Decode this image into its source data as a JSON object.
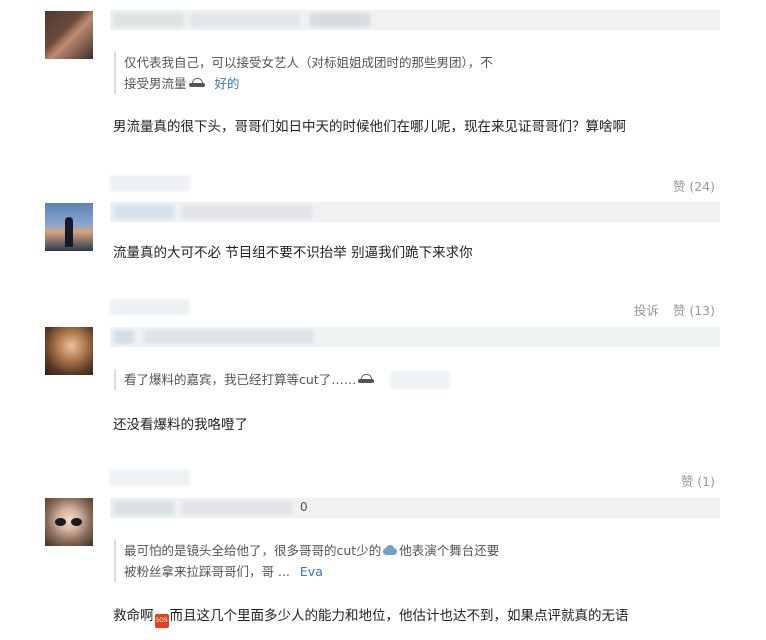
{
  "comments": [
    {
      "quote_text_line1": "仅代表我自己，可以接受女艺人（对标姐姐成团时的那些男团），不",
      "quote_text_line2": "接受男流量",
      "quote_link": "好的",
      "icon": "shoe-icon",
      "text": "男流量真的很下头，哥哥们如日中天的时候他们在哪儿呢，现在来见证哥哥们？算啥啊",
      "likes": "赞 (24)"
    },
    {
      "text": "流量真的大可不必 节目组不要不识抬举 别逼我们跪下来求你",
      "report": "投诉",
      "likes": "赞 (13)"
    },
    {
      "quote_text": "看了爆料的嘉宾，我已经打算等cut了……",
      "icon": "shoe-icon",
      "text": "还没看爆料的我咯噔了",
      "likes": "赞 (1)"
    },
    {
      "name_suffix": "0",
      "quote_text_line1a": "最可怕的是镜头全给他了，很多哥哥的cut少的",
      "quote_text_line1b": "他表演个舞台还要",
      "quote_text_line2": "被粉丝拿来拉踩哥哥们，哥 ...",
      "quote_link": "Eva",
      "text_a": "救命啊",
      "text_b": "而且这几个里面多少人的能力和地位，他估计也达不到，如果点评就真的无语",
      "sos_label": "SOS"
    }
  ]
}
